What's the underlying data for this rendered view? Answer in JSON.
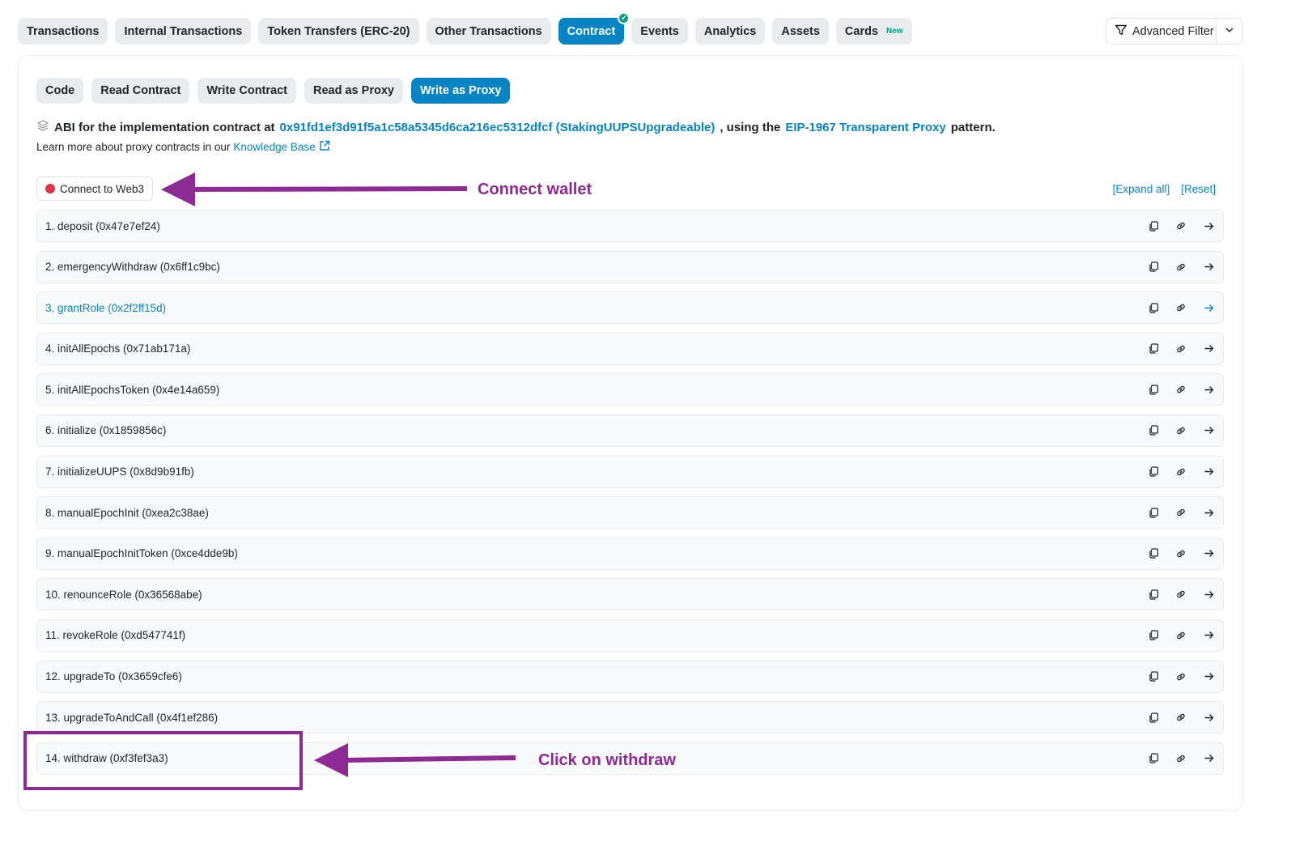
{
  "top_tabs": [
    {
      "label": "Transactions",
      "active": false
    },
    {
      "label": "Internal Transactions",
      "active": false
    },
    {
      "label": "Token Transfers (ERC-20)",
      "active": false
    },
    {
      "label": "Other Transactions",
      "active": false
    },
    {
      "label": "Contract",
      "active": true,
      "verified_icon": "check-circle-icon"
    },
    {
      "label": "Events",
      "active": false
    },
    {
      "label": "Analytics",
      "active": false
    },
    {
      "label": "Assets",
      "active": false
    },
    {
      "label": "Cards",
      "active": false,
      "badge": "New"
    }
  ],
  "filter": {
    "label": "Advanced Filter",
    "icon": "filter-icon",
    "caret_icon": "chevron-down-icon"
  },
  "sub_tabs": [
    {
      "label": "Code",
      "active": false
    },
    {
      "label": "Read Contract",
      "active": false
    },
    {
      "label": "Write Contract",
      "active": false
    },
    {
      "label": "Read as Proxy",
      "active": false
    },
    {
      "label": "Write as Proxy",
      "active": true
    }
  ],
  "abi": {
    "prefix": "ABI for the implementation contract at",
    "address": "0x91fd1ef3d91f5a1c58a5345d6ca216ec5312dfcf (StakingUUPSUpgradeable)",
    "middle": ", using the",
    "pattern_link": "EIP-1967 Transparent Proxy",
    "suffix": "pattern.",
    "learn_prefix": "Learn more about proxy contracts in our",
    "learn_link": "Knowledge Base"
  },
  "connect_label": "Connect to Web3",
  "expand_all": "[Expand all]",
  "reset": "[Reset]",
  "functions": [
    {
      "label": "1. deposit (0x47e7ef24)",
      "highlighted": false
    },
    {
      "label": "2. emergencyWithdraw (0x6ff1c9bc)",
      "highlighted": false
    },
    {
      "label": "3. grantRole (0x2f2ff15d)",
      "highlighted": true
    },
    {
      "label": "4. initAllEpochs (0x71ab171a)",
      "highlighted": false
    },
    {
      "label": "5. initAllEpochsToken (0x4e14a659)",
      "highlighted": false
    },
    {
      "label": "6. initialize (0x1859856c)",
      "highlighted": false
    },
    {
      "label": "7. initializeUUPS (0x8d9b91fb)",
      "highlighted": false
    },
    {
      "label": "8. manualEpochInit (0xea2c38ae)",
      "highlighted": false
    },
    {
      "label": "9. manualEpochInitToken (0xce4dde9b)",
      "highlighted": false
    },
    {
      "label": "10. renounceRole (0x36568abe)",
      "highlighted": false
    },
    {
      "label": "11. revokeRole (0xd547741f)",
      "highlighted": false
    },
    {
      "label": "12. upgradeTo (0x3659cfe6)",
      "highlighted": false
    },
    {
      "label": "13. upgradeToAndCall (0x4f1ef286)",
      "highlighted": false
    },
    {
      "label": "14. withdraw (0xf3fef3a3)",
      "highlighted": false
    }
  ],
  "annotations": {
    "connect": "Connect wallet",
    "withdraw": "Click on withdraw",
    "color": "#8e2a93"
  },
  "colors": {
    "accent": "#0784c3",
    "annotation": "#8e2a93",
    "danger": "#dc3545",
    "success": "#00a186"
  }
}
